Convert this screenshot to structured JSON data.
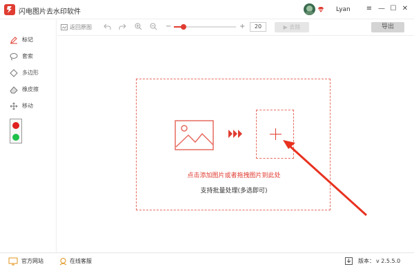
{
  "app": {
    "title": "闪电图片去水印软件",
    "username": "Lyan"
  },
  "window_controls": {
    "menu": "≡",
    "minimize": "—",
    "maximize": "☐",
    "close": "✕"
  },
  "toolbar": {
    "return_original_label": "返回原图",
    "zoom_minus": "−",
    "zoom_plus": "+",
    "zoom_value": "20",
    "zoom_level": 0.15,
    "remove_label": "▶ 去除",
    "export_label": "导出"
  },
  "sidebar": {
    "tools": [
      {
        "label": "标记",
        "icon": "pen-icon"
      },
      {
        "label": "套索",
        "icon": "lasso-icon"
      },
      {
        "label": "多边形",
        "icon": "polygon-icon"
      },
      {
        "label": "橡皮擦",
        "icon": "eraser-icon"
      },
      {
        "label": "移动",
        "icon": "move-icon"
      }
    ],
    "color_red": "#e02020",
    "color_green": "#1ec04a"
  },
  "dropzone": {
    "hint_primary": "点击添加图片或者拖拽图片到此处",
    "hint_secondary": "支持批量处理(多选即可)"
  },
  "statusbar": {
    "website_label": "官方网站",
    "support_label": "在线客服",
    "version_label": "版本：",
    "version_value": "v 2.5.5.0"
  },
  "colors": {
    "accent": "#e03c31",
    "dashed_border": "#e76a5f"
  }
}
